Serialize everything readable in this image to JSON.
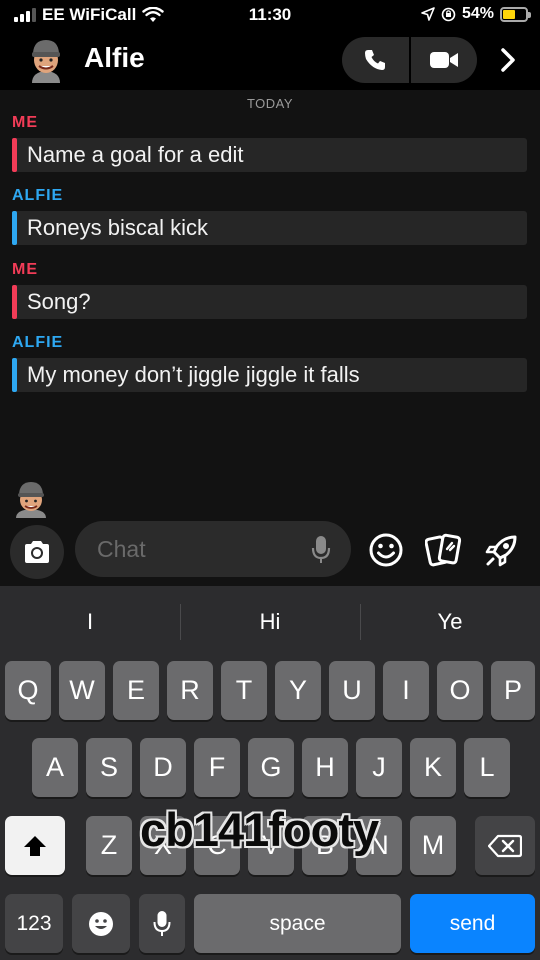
{
  "status_bar": {
    "carrier": "EE WiFiCall",
    "time": "11:30",
    "battery_percent": "54%",
    "battery_level": 0.54,
    "icons": [
      "signal-icon",
      "wifi-icon",
      "location-arrow-icon",
      "rotation-lock-icon",
      "battery-icon"
    ]
  },
  "header": {
    "contact_name": "Alfie",
    "icons": [
      "bitmoji-avatar",
      "phone-icon",
      "video-icon",
      "chevron-right-icon"
    ]
  },
  "chat": {
    "date_label": "TODAY",
    "messages": [
      {
        "sender": "ME",
        "text": "Name a goal for a edit"
      },
      {
        "sender": "ALFIE",
        "text": "Roneys biscal kick"
      },
      {
        "sender": "ME",
        "text": "Song?"
      },
      {
        "sender": "ALFIE",
        "text": "My money don’t jiggle jiggle it falls"
      }
    ],
    "colors": {
      "me": "#f23c57",
      "alfie": "#2ea8f2"
    }
  },
  "input_bar": {
    "placeholder": "Chat",
    "icons": [
      "camera-icon",
      "microphone-icon",
      "smiley-icon",
      "cards-icon",
      "rocket-icon"
    ]
  },
  "keyboard": {
    "predictions": [
      "I",
      "Hi",
      "Ye"
    ],
    "row1": [
      "Q",
      "W",
      "E",
      "R",
      "T",
      "Y",
      "U",
      "I",
      "O",
      "P"
    ],
    "row2": [
      "A",
      "S",
      "D",
      "F",
      "G",
      "H",
      "J",
      "K",
      "L"
    ],
    "row3": [
      "Z",
      "X",
      "C",
      "V",
      "B",
      "N",
      "M"
    ],
    "numbers_label": "123",
    "space_label": "space",
    "send_label": "send",
    "accent": "#0a84ff"
  },
  "watermark": "cb141footy"
}
